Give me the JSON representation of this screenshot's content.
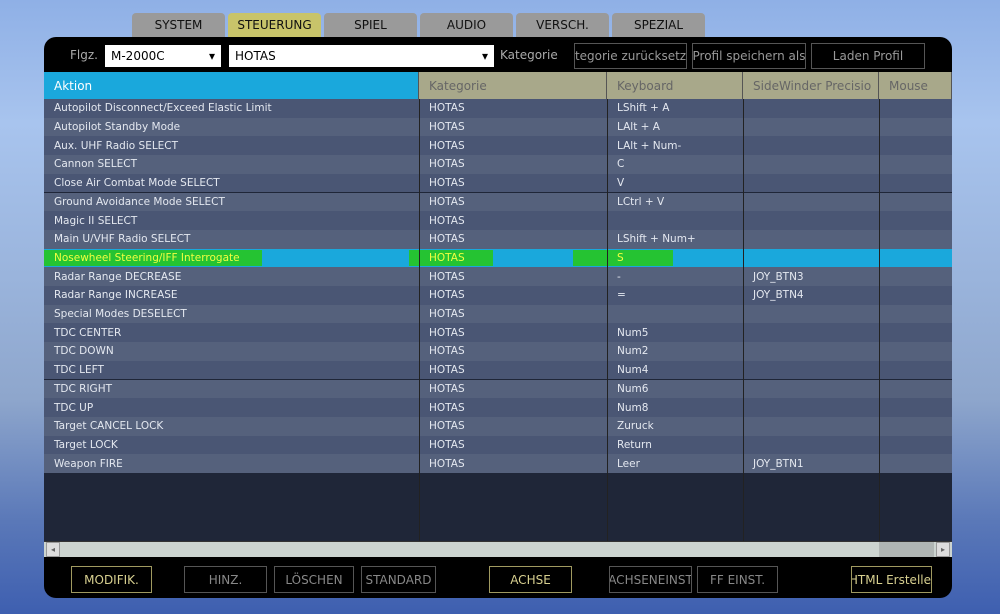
{
  "tabs": [
    "SYSTEM",
    "STEUERUNG",
    "SPIEL",
    "AUDIO",
    "VERSCH.",
    "SPEZIAL"
  ],
  "active_tab": "STEUERUNG",
  "toolbar": {
    "aircraft_label": "Flgz.",
    "aircraft_value": "M-2000C",
    "category_value": "HOTAS",
    "category_label": "Kategorie",
    "reset_category": "tegorie zurücksetz",
    "save_profile": "Profil speichern als",
    "load_profile": "Laden Profil"
  },
  "columns": [
    "Aktion",
    "Kategorie",
    "Keyboard",
    "SideWinder Precisio",
    "Mouse"
  ],
  "rows": [
    [
      "Autopilot Disconnect/Exceed Elastic Limit",
      "HOTAS",
      "LShift + A",
      ""
    ],
    [
      "Autopilot Standby Mode",
      "HOTAS",
      "LAlt + A",
      ""
    ],
    [
      "Aux. UHF Radio SELECT",
      "HOTAS",
      "LAlt + Num-",
      ""
    ],
    [
      "Cannon SELECT",
      "HOTAS",
      "C",
      ""
    ],
    [
      "Close Air Combat Mode SELECT",
      "HOTAS",
      "V",
      ""
    ],
    [
      "Ground Avoidance Mode SELECT",
      "HOTAS",
      "LCtrl + V",
      ""
    ],
    [
      "Magic II SELECT",
      "HOTAS",
      "",
      ""
    ],
    [
      "Main U/VHF Radio SELECT",
      "HOTAS",
      "LShift + Num+",
      ""
    ],
    [
      "Nosewheel Steering/IFF Interrogate",
      "HOTAS",
      "S",
      ""
    ],
    [
      "Radar Range DECREASE",
      "HOTAS",
      "-",
      "JOY_BTN3"
    ],
    [
      "Radar Range INCREASE",
      "HOTAS",
      "=",
      "JOY_BTN4"
    ],
    [
      "Special Modes DESELECT",
      "HOTAS",
      "",
      ""
    ],
    [
      "TDC CENTER",
      "HOTAS",
      "Num5",
      ""
    ],
    [
      "TDC DOWN",
      "HOTAS",
      "Num2",
      ""
    ],
    [
      "TDC LEFT",
      "HOTAS",
      "Num4",
      ""
    ],
    [
      "TDC RIGHT",
      "HOTAS",
      "Num6",
      ""
    ],
    [
      "TDC UP",
      "HOTAS",
      "Num8",
      ""
    ],
    [
      "Target CANCEL LOCK",
      "HOTAS",
      "Zuruck",
      ""
    ],
    [
      "Target LOCK",
      "HOTAS",
      "Return",
      ""
    ],
    [
      "Weapon FIRE",
      "HOTAS",
      "Leer",
      "JOY_BTN1"
    ]
  ],
  "selected_row": 8,
  "bottom": {
    "modifiers": "MODIFIK.",
    "add": "HINZ.",
    "delete": "LÖSCHEN",
    "default": "STANDARD",
    "axis": "ACHSE",
    "axis_tune": "ACHSENEINST",
    "ff_tune": "FF EINST.",
    "make_html": "HTML Erstelle"
  },
  "scroll": {
    "left": "◂",
    "right": "▸"
  },
  "colors": {
    "accent": "#1aa8dc",
    "active_tab": "#c8c46a",
    "highlight": "#28c814"
  }
}
